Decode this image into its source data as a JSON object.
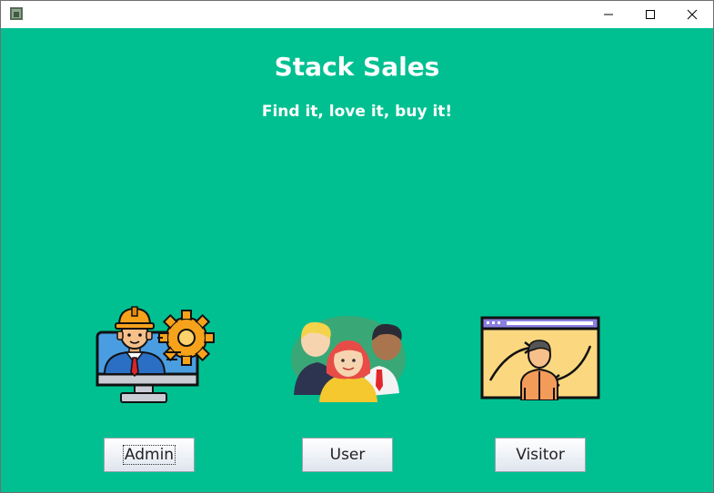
{
  "window": {
    "title": ""
  },
  "header": {
    "title": "Stack Sales",
    "subtitle": "Find it, love it, buy it!"
  },
  "buttons": {
    "admin": "Admin",
    "user": "User",
    "visitor": "Visitor"
  },
  "colors": {
    "background": "#00c091",
    "text": "#ffffff"
  },
  "icons": [
    "app-icon",
    "minimize-icon",
    "maximize-icon",
    "close-icon",
    "admin-engineer-icon",
    "user-group-icon",
    "visitor-screen-icon"
  ]
}
